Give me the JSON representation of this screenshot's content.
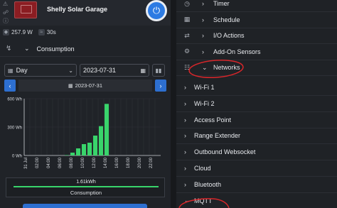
{
  "device": {
    "name": "Shelly Solar Garage",
    "power_icon": "power-icon",
    "power_label": "⏻"
  },
  "stats": {
    "power": "257.9 W",
    "interval": "30s"
  },
  "consumption_section": {
    "label": "Consumption",
    "icon": "bolt-icon"
  },
  "controls": {
    "period": "Day",
    "date": "2023-07-31",
    "nav_date": "2023-07-31"
  },
  "chart_data": {
    "type": "bar",
    "categories": [
      "31 Jul",
      "01:00",
      "02:00",
      "03:00",
      "04:00",
      "05:00",
      "06:00",
      "07:00",
      "08:00",
      "09:00",
      "10:00",
      "11:00",
      "12:00",
      "13:00",
      "14:00",
      "15:00",
      "16:00",
      "17:00",
      "18:00",
      "19:00",
      "20:00",
      "21:00",
      "22:00",
      "23:00"
    ],
    "tick_labels": [
      "31 Jul",
      "02:00",
      "04:00",
      "06:00",
      "08:00",
      "10:00",
      "12:00",
      "14:00",
      "16:00",
      "18:00",
      "20:00",
      "22:00"
    ],
    "tick_categories": [
      "31 Jul",
      "02:00",
      "04:00",
      "06:00",
      "08:00",
      "10:00",
      "12:00",
      "14:00",
      "16:00",
      "18:00",
      "20:00",
      "22:00"
    ],
    "values": [
      0,
      0,
      0,
      0,
      0,
      0,
      0,
      4,
      30,
      75,
      120,
      135,
      210,
      310,
      545,
      0,
      0,
      0,
      0,
      0,
      0,
      0,
      0,
      0
    ],
    "y_ticks": [
      0,
      300,
      600
    ],
    "y_tick_labels": [
      "0 Wh",
      "300 Wh",
      "600 Wh"
    ],
    "ylim": [
      0,
      600
    ],
    "bar_color": "#39d46b",
    "grid": true
  },
  "total": {
    "value": "1.61kWh",
    "label": "Consumption",
    "line_color": "#39d46b"
  },
  "menu": [
    {
      "label": "Timer",
      "icon": "clock-icon",
      "glyph": "◷",
      "chev": "›"
    },
    {
      "label": "Schedule",
      "icon": "calendar-icon",
      "glyph": "▦",
      "chev": "›"
    },
    {
      "label": "I/O Actions",
      "icon": "arrows-icon",
      "glyph": "⇄",
      "chev": "›"
    },
    {
      "label": "Add-On Sensors",
      "icon": "sensor-icon",
      "glyph": "⚙",
      "chev": "›"
    },
    {
      "label": "Networks",
      "icon": "network-icon",
      "glyph": "☷",
      "chev": "⌄"
    }
  ],
  "submenu": [
    {
      "label": "Wi-Fi 1",
      "chev": "›"
    },
    {
      "label": "Wi-Fi 2",
      "chev": "›"
    },
    {
      "label": "Access Point",
      "chev": "›"
    },
    {
      "label": "Range Extender",
      "chev": "›"
    },
    {
      "label": "Outbound Websocket",
      "chev": "›"
    },
    {
      "label": "Cloud",
      "chev": "›"
    },
    {
      "label": "Bluetooth",
      "chev": "›"
    },
    {
      "label": "MQTT",
      "chev": "⌄"
    }
  ],
  "annotation_color": "#d8262a"
}
